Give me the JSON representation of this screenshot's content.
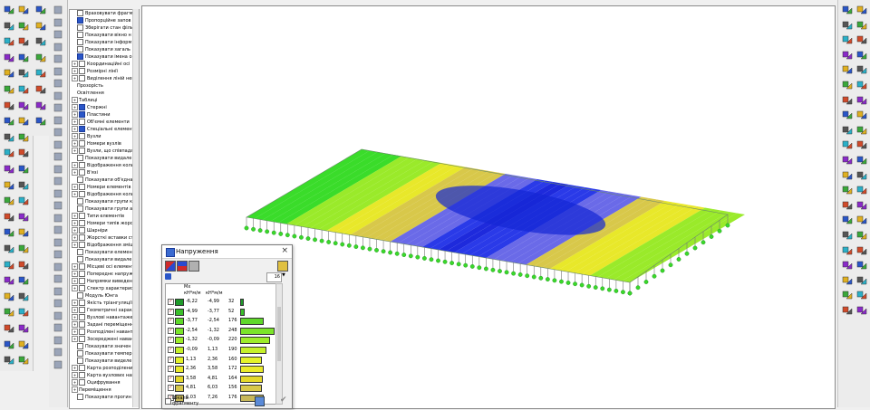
{
  "tree": {
    "items": [
      {
        "label": "Враховувати фрагм",
        "expand": "",
        "checked": false,
        "indent": 1
      },
      {
        "label": "Пропорційне запов",
        "expand": "",
        "checked": true,
        "indent": 1
      },
      {
        "label": "Зберігати стан фільт",
        "expand": "",
        "checked": false,
        "indent": 1
      },
      {
        "label": "Показувати вікно н",
        "expand": "",
        "checked": false,
        "indent": 1
      },
      {
        "label": "Показувати інформ",
        "expand": "",
        "checked": false,
        "indent": 1
      },
      {
        "label": "Показувати загаль",
        "expand": "",
        "checked": false,
        "indent": 1
      },
      {
        "label": "Показувати імена о",
        "expand": "",
        "checked": true,
        "indent": 1
      },
      {
        "label": "Координаційні осі",
        "expand": "+",
        "checked": false,
        "indent": 0
      },
      {
        "label": "Розмірні лінії",
        "expand": "+",
        "checked": false,
        "indent": 0
      },
      {
        "label": "Виділення ліній нев",
        "expand": "+",
        "checked": false,
        "indent": 0
      },
      {
        "label": "Прозорість",
        "expand": "",
        "checked": null,
        "indent": 1
      },
      {
        "label": "Освітлення",
        "expand": "",
        "checked": null,
        "indent": 1
      },
      {
        "label": "Таблиці",
        "expand": "+",
        "checked": null,
        "indent": 0
      },
      {
        "label": "Стержні",
        "expand": "+",
        "checked": true,
        "indent": 0
      },
      {
        "label": "Пластини",
        "expand": "+",
        "checked": true,
        "indent": 0
      },
      {
        "label": "Об'ємні елементи",
        "expand": "+",
        "checked": false,
        "indent": 0
      },
      {
        "label": "Спеціальні елемент",
        "expand": "+",
        "checked": true,
        "indent": 0
      },
      {
        "label": "Вузли",
        "expand": "+",
        "checked": false,
        "indent": 0
      },
      {
        "label": "Номери вузлів",
        "expand": "+",
        "checked": false,
        "indent": 0
      },
      {
        "label": "Вузли, що співпада",
        "expand": "+",
        "checked": false,
        "indent": 0
      },
      {
        "label": "Показувати видалe",
        "expand": "",
        "checked": false,
        "indent": 1
      },
      {
        "label": "Відображення колы",
        "expand": "+",
        "checked": false,
        "indent": 0
      },
      {
        "label": "В'язі",
        "expand": "+",
        "checked": false,
        "indent": 0
      },
      {
        "label": "Показувати об'єдна",
        "expand": "",
        "checked": false,
        "indent": 1
      },
      {
        "label": "Номери елементів",
        "expand": "+",
        "checked": false,
        "indent": 0
      },
      {
        "label": "Відображення колы",
        "expand": "+",
        "checked": false,
        "indent": 0
      },
      {
        "label": "Показувати групи к",
        "expand": "",
        "checked": false,
        "indent": 1
      },
      {
        "label": "Показувати групи а",
        "expand": "",
        "checked": false,
        "indent": 1
      },
      {
        "label": "Типи елементів",
        "expand": "+",
        "checked": false,
        "indent": 0
      },
      {
        "label": "Номери типів жорст",
        "expand": "+",
        "checked": false,
        "indent": 0
      },
      {
        "label": "Шарніри",
        "expand": "+",
        "checked": false,
        "indent": 0
      },
      {
        "label": "Жорсткі вставки ст",
        "expand": "+",
        "checked": false,
        "indent": 0
      },
      {
        "label": "Відображення змішц",
        "expand": "+",
        "checked": false,
        "indent": 0
      },
      {
        "label": "Показувати елемен",
        "expand": "",
        "checked": false,
        "indent": 1
      },
      {
        "label": "Показувати видале",
        "expand": "",
        "checked": false,
        "indent": 1
      },
      {
        "label": "Місцеві осі елемент",
        "expand": "+",
        "checked": false,
        "indent": 0
      },
      {
        "label": "Попереднє напруже",
        "expand": "+",
        "checked": false,
        "indent": 0
      },
      {
        "label": "Напрямки виведени",
        "expand": "+",
        "checked": false,
        "indent": 0
      },
      {
        "label": "Спектр характерист",
        "expand": "+",
        "checked": false,
        "indent": 0
      },
      {
        "label": "Модуль Юнга",
        "expand": "",
        "checked": false,
        "indent": 1
      },
      {
        "label": "Якість тріангуляції",
        "expand": "+",
        "checked": false,
        "indent": 0
      },
      {
        "label": "Геометричні характ",
        "expand": "+",
        "checked": false,
        "indent": 0
      },
      {
        "label": "Вузлові навантажен",
        "expand": "+",
        "checked": false,
        "indent": 0
      },
      {
        "label": "Задані переміщення",
        "expand": "+",
        "checked": false,
        "indent": 0
      },
      {
        "label": "Розподілені навант",
        "expand": "+",
        "checked": false,
        "indent": 0
      },
      {
        "label": "Зосереджені навант",
        "expand": "+",
        "checked": false,
        "indent": 0
      },
      {
        "label": "Показувати значен",
        "expand": "",
        "checked": false,
        "indent": 1
      },
      {
        "label": "Показувати темпер",
        "expand": "",
        "checked": false,
        "indent": 1
      },
      {
        "label": "Показувати виделе",
        "expand": "",
        "checked": false,
        "indent": 1
      },
      {
        "label": "Карта розподілених",
        "expand": "+",
        "checked": false,
        "indent": 0
      },
      {
        "label": "Карта вузлових нав",
        "expand": "+",
        "checked": false,
        "indent": 0
      },
      {
        "label": "Оцифрування",
        "expand": "+",
        "checked": false,
        "indent": 0
      },
      {
        "label": "Переміщення",
        "expand": "+",
        "checked": null,
        "indent": 0
      },
      {
        "label": "Показувати прогин",
        "expand": "",
        "checked": false,
        "indent": 1
      }
    ]
  },
  "dialog": {
    "title": "Напруження",
    "close": "×",
    "count_value": "16",
    "table_header_label": "Мx",
    "unit_from": "кН*м/м",
    "unit_to": "кН*м/м",
    "rows": [
      {
        "from": "-6,22",
        "to": "-4,99",
        "count": "32",
        "color": "#1f9a2a",
        "fill": 0.04
      },
      {
        "from": "-4,99",
        "to": "-3,77",
        "count": "52",
        "color": "#3bbe2a",
        "fill": 0.07
      },
      {
        "from": "-3,77",
        "to": "-2,54",
        "count": "176",
        "color": "#5fd82a",
        "fill": 0.68
      },
      {
        "from": "-2,54",
        "to": "-1,32",
        "count": "248",
        "color": "#7be42a",
        "fill": 1.0
      },
      {
        "from": "-1,32",
        "to": "-0,09",
        "count": "220",
        "color": "#9eed2a",
        "fill": 0.86
      },
      {
        "from": "-0,09",
        "to": "1,13",
        "count": "190",
        "color": "#c6f12a",
        "fill": 0.75
      },
      {
        "from": "1,13",
        "to": "2,36",
        "count": "160",
        "color": "#e4f22a",
        "fill": 0.62
      },
      {
        "from": "2,36",
        "to": "3,58",
        "count": "172",
        "color": "#eaea2a",
        "fill": 0.68
      },
      {
        "from": "3,58",
        "to": "4,81",
        "count": "164",
        "color": "#e4d82a",
        "fill": 0.64
      },
      {
        "from": "4,81",
        "to": "6,03",
        "count": "156",
        "color": "#d8c84a",
        "fill": 0.6
      },
      {
        "from": "6,03",
        "to": "7,26",
        "count": "176",
        "color": "#c8b85a",
        "fill": 0.68
      }
    ],
    "footer_label_1": "Шкала",
    "footer_label_2": "фрагменту"
  },
  "colors": {
    "accent": "#2a56c8",
    "plate_blue": "#1e3adc",
    "plate_green": "#3adc2a",
    "plate_yellow": "#e8e82a"
  }
}
